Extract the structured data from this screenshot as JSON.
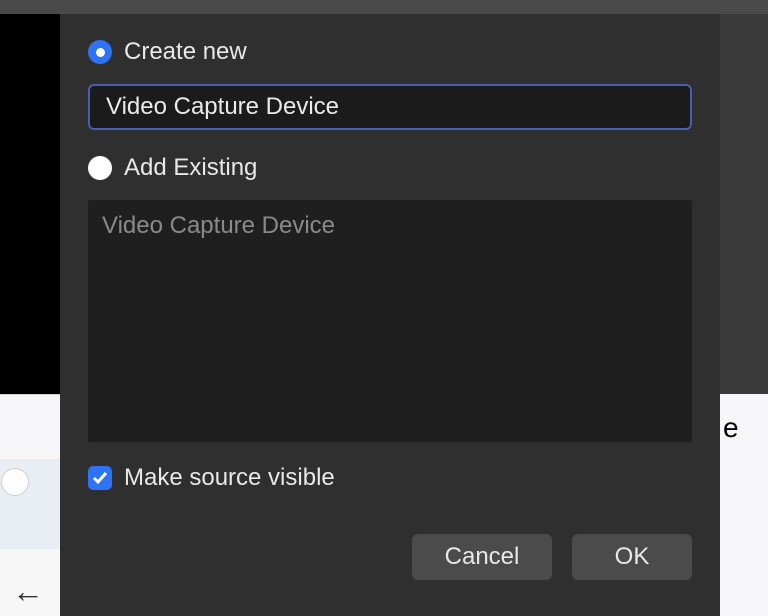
{
  "dialog": {
    "create_new": {
      "label": "Create new",
      "selected": true,
      "input_value": "Video Capture Device"
    },
    "add_existing": {
      "label": "Add Existing",
      "selected": false,
      "items": [
        "Video Capture Device"
      ]
    },
    "make_visible": {
      "label": "Make source visible",
      "checked": true
    },
    "buttons": {
      "cancel": "Cancel",
      "ok": "OK"
    }
  },
  "background": {
    "right_text_fragment": "e"
  }
}
